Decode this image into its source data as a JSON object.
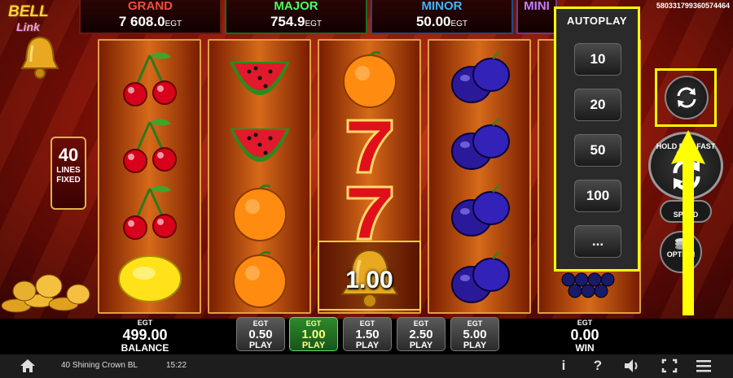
{
  "logo": {
    "line1": "BELL",
    "line2": "Link"
  },
  "jackpots": {
    "grand": {
      "name": "GRAND",
      "value": "7 608.0",
      "currency": "EGT"
    },
    "major": {
      "name": "MAJOR",
      "value": "754.9",
      "currency": "EGT"
    },
    "minor": {
      "name": "MINOR",
      "value": "50.00",
      "currency": "EGT"
    },
    "mini": {
      "name": "MINI"
    }
  },
  "session_id": "580331799360574464",
  "lines": {
    "count": "40",
    "label1": "LINES",
    "label2": "FIXED"
  },
  "reels": [
    [
      "cherries",
      "cherries",
      "cherries",
      "lemon"
    ],
    [
      "watermelon",
      "watermelon",
      "orange",
      "orange"
    ],
    [
      "orange",
      "seven",
      "seven",
      "bell"
    ],
    [
      "plum",
      "plum",
      "plum",
      "plum"
    ],
    [
      "",
      "",
      "",
      "grapes"
    ]
  ],
  "bell_win_value": "1.00",
  "autoplay": {
    "title": "AUTOPLAY",
    "options": [
      "10",
      "20",
      "50",
      "100",
      "..."
    ]
  },
  "controls": {
    "spin_hint": "HOLD FOR FAST PLAY",
    "speed_label": "SPEED",
    "options_label": "OPTION"
  },
  "balance": {
    "currency": "EGT",
    "value": "499.00",
    "label": "BALANCE"
  },
  "win": {
    "currency": "EGT",
    "value": "0.00",
    "label": "WIN"
  },
  "bets": [
    {
      "currency": "EGT",
      "value": "0.50",
      "label": "PLAY",
      "active": false
    },
    {
      "currency": "EGT",
      "value": "1.00",
      "label": "PLAY",
      "active": true
    },
    {
      "currency": "EGT",
      "value": "1.50",
      "label": "PLAY",
      "active": false
    },
    {
      "currency": "EGT",
      "value": "2.50",
      "label": "PLAY",
      "active": false
    },
    {
      "currency": "EGT",
      "value": "5.00",
      "label": "PLAY",
      "active": false
    }
  ],
  "status_bar": {
    "game_name": "40 Shining Crown BL",
    "time": "15:22",
    "info_glyph": "i",
    "help_glyph": "?"
  },
  "colors": {
    "highlight": "#ffff00",
    "grand": "#ff4a3a",
    "major": "#4cff5a",
    "minor": "#3fb4ff",
    "active_bet": "#2e8a2a"
  }
}
